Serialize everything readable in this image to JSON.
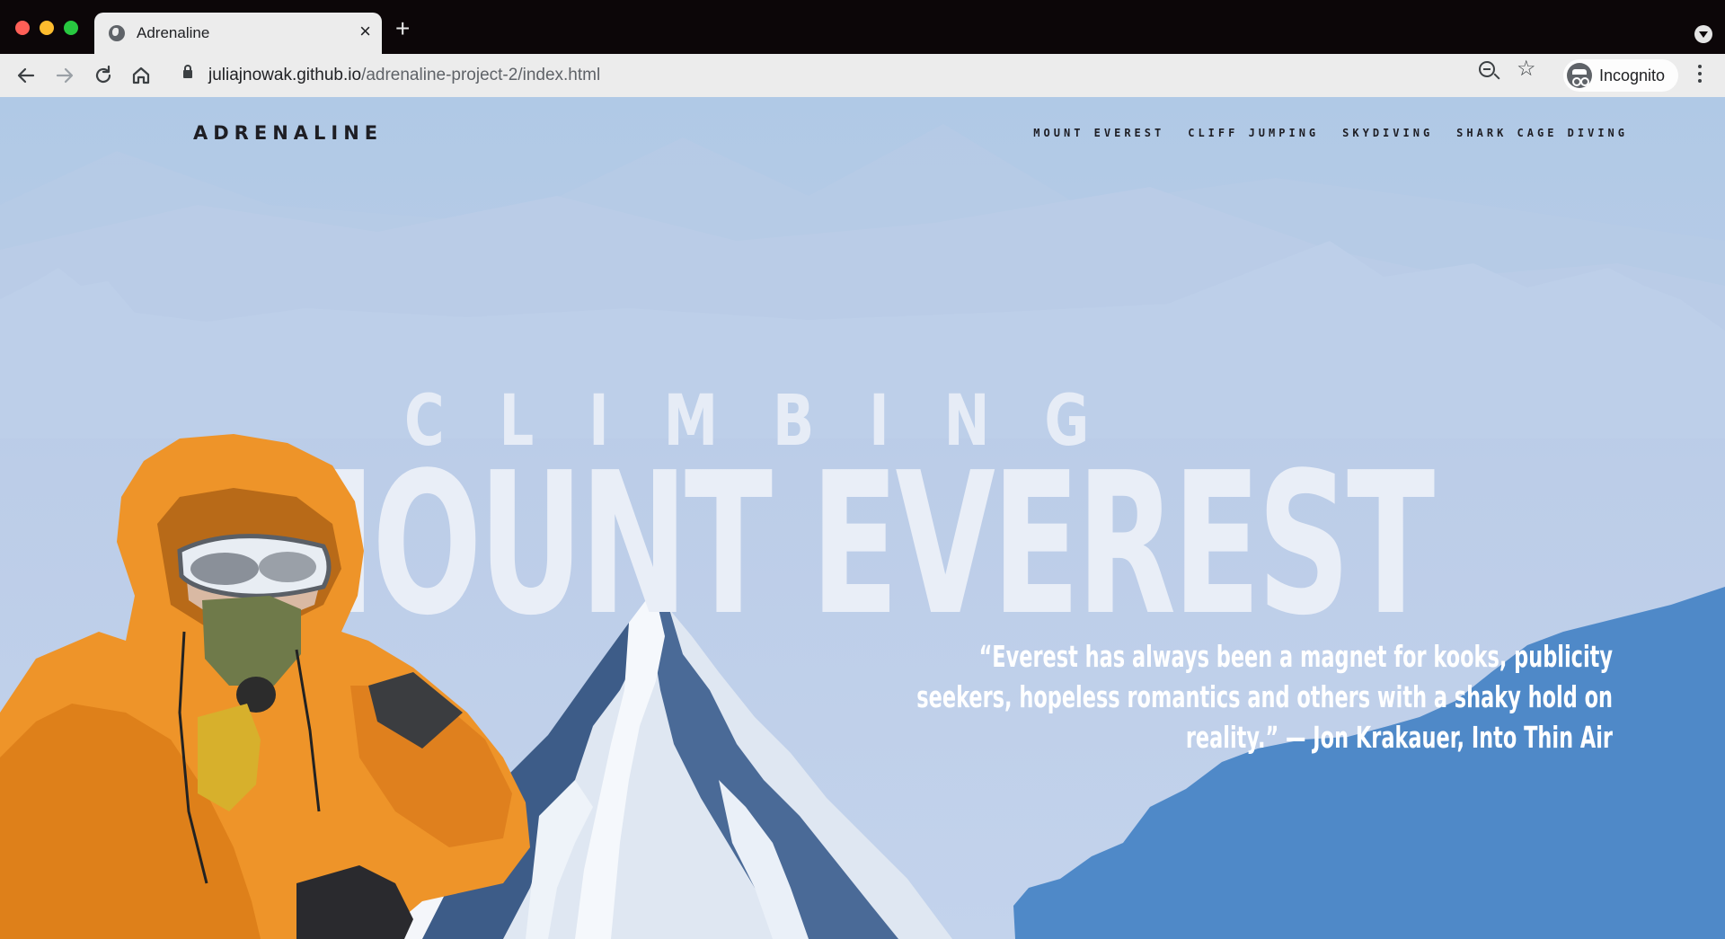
{
  "browser": {
    "tab_title": "Adrenaline",
    "tab_close": "×",
    "new_tab": "+",
    "url_host": "juliajnowak.github.io",
    "url_path": "/adrenaline-project-2/index.html",
    "profile_label": "Incognito",
    "icons": [
      "back-arrow-icon",
      "forward-arrow-icon",
      "reload-icon",
      "home-icon",
      "lock-icon",
      "zoom-out-icon",
      "star-icon",
      "incognito-icon",
      "kebab-menu-icon",
      "globe-favicon-icon"
    ]
  },
  "site": {
    "logo": "ADRENALINE",
    "nav": [
      "MOUNT EVEREST",
      "CLIFF JUMPING",
      "SKYDIVING",
      "SHARK CAGE DIVING"
    ],
    "hero_kicker": "CLIMBING",
    "hero_title": "MOUNT EVEREST",
    "quote": "“Everest has always been a magnet for kooks, publicity seekers, hopeless romantics and others with a shaky hold on reality.” — Jon Krakauer, Into Thin Air",
    "colors": {
      "sky": "#b0c9e6",
      "accent_blue": "#4e88c7",
      "hero_text": "#e9eef7",
      "jacket_orange": "#f0972a"
    }
  }
}
